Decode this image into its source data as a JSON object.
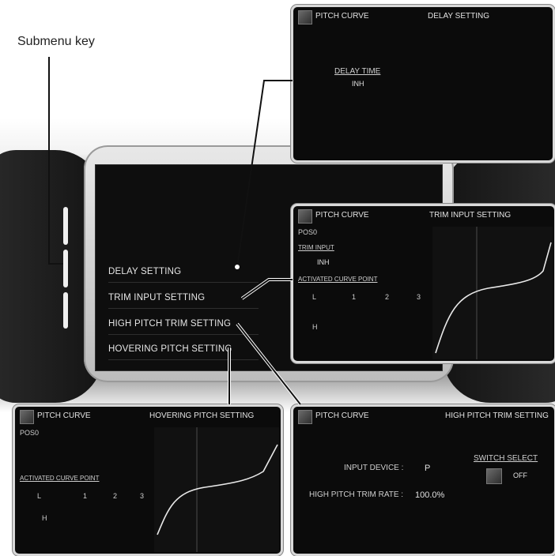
{
  "annotation": {
    "submenu_key_label": "Submenu key"
  },
  "screen_menu": {
    "items": [
      {
        "label": "DELAY SETTING"
      },
      {
        "label": "TRIM INPUT SETTING"
      },
      {
        "label": "HIGH PITCH TRIM SETTING"
      },
      {
        "label": "HOVERING PITCH SETTING"
      }
    ]
  },
  "delay_panel": {
    "title": "PITCH CURVE",
    "subtitle": "DELAY SETTING",
    "delay_time_label": "DELAY TIME",
    "delay_time_value": "INH"
  },
  "trim_input_panel": {
    "title": "PITCH CURVE",
    "subtitle": "TRIM INPUT SETTING",
    "pos": "POS0",
    "trim_input_label": "TRIM INPUT",
    "trim_input_value": "INH",
    "activated_label": "ACTIVATED CURVE POINT",
    "points": [
      "L",
      "1",
      "2",
      "3"
    ],
    "point_h": "H"
  },
  "hovering_panel": {
    "title": "PITCH CURVE",
    "subtitle": "HOVERING PITCH SETTING",
    "pos": "POS0",
    "activated_label": "ACTIVATED CURVE POINT",
    "points": [
      "L",
      "1",
      "2",
      "3"
    ],
    "point_h": "H"
  },
  "high_pitch_panel": {
    "title": "PITCH CURVE",
    "subtitle": "HIGH PITCH TRIM SETTING",
    "input_device_label": "INPUT DEVICE :",
    "input_device_value": "P",
    "trim_rate_label": "HIGH PITCH TRIM RATE :",
    "trim_rate_value": "100.0%",
    "switch_select_label": "SWITCH SELECT",
    "switch_value": "OFF"
  },
  "colors": {
    "panel_bg": "#0b0b0b",
    "panel_border": "#d9d9d9",
    "curve": "#e8e8e8"
  }
}
